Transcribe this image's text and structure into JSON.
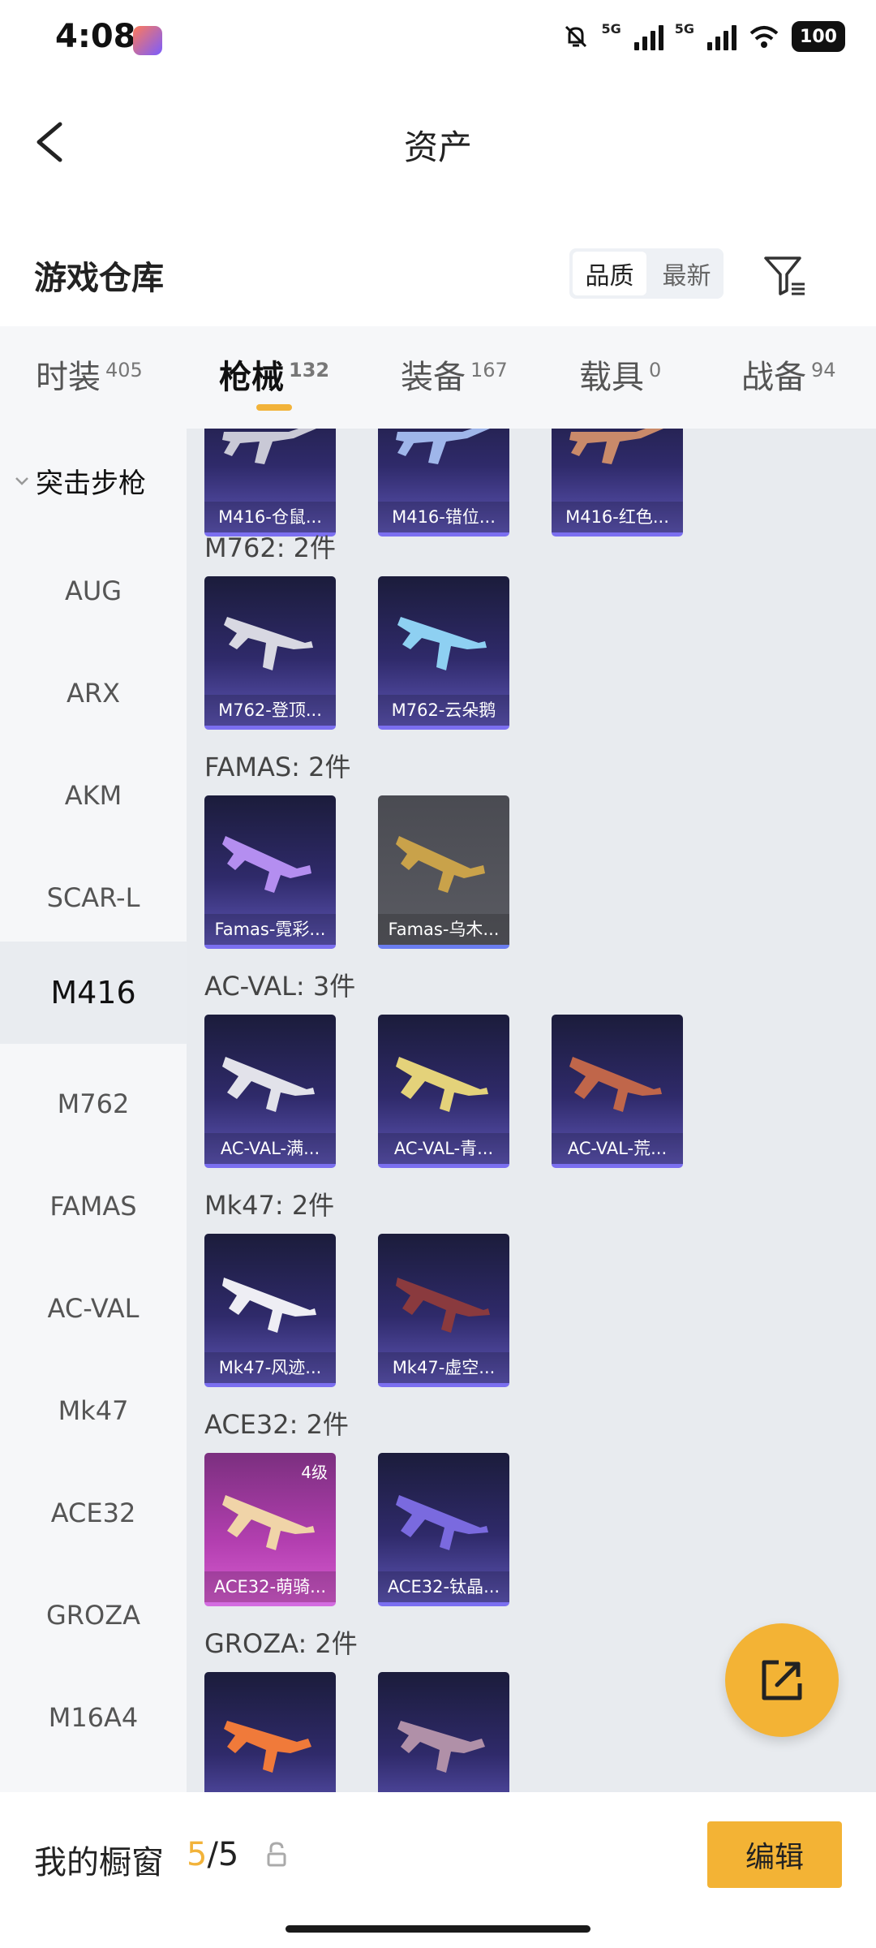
{
  "status": {
    "time": "4:08",
    "battery": "100",
    "net1": "5G",
    "net2": "5G"
  },
  "header": {
    "title": "资产"
  },
  "section": {
    "title": "游戏仓库",
    "sort_options": [
      "品质",
      "最新"
    ],
    "active_sort": "品质"
  },
  "tabs": [
    {
      "label": "时装",
      "count": "405"
    },
    {
      "label": "枪械",
      "count": "132"
    },
    {
      "label": "装备",
      "count": "167"
    },
    {
      "label": "载具",
      "count": "0"
    },
    {
      "label": "战备",
      "count": "94"
    }
  ],
  "active_tab": "枪械",
  "sidebar": {
    "category": "突击步枪",
    "items": [
      "AUG",
      "ARX",
      "AKM",
      "SCAR-L",
      "M416",
      "M762",
      "FAMAS",
      "AC-VAL",
      "Mk47",
      "ACE32",
      "GROZA",
      "M16A4"
    ],
    "active": "M416"
  },
  "groups": [
    {
      "title": "",
      "items": [
        {
          "label": "M416-仓鼠..."
        },
        {
          "label": "M416-错位..."
        },
        {
          "label": "M416-红色..."
        }
      ]
    },
    {
      "title": "M762: 2件",
      "items": [
        {
          "label": "M762-登顶..."
        },
        {
          "label": "M762-云朵鹅"
        }
      ]
    },
    {
      "title": "FAMAS: 2件",
      "items": [
        {
          "label": "Famas-霓彩..."
        },
        {
          "label": "Famas-乌木..."
        }
      ]
    },
    {
      "title": "AC-VAL: 3件",
      "items": [
        {
          "label": "AC-VAL-满..."
        },
        {
          "label": "AC-VAL-青..."
        },
        {
          "label": "AC-VAL-荒..."
        }
      ]
    },
    {
      "title": "Mk47: 2件",
      "items": [
        {
          "label": "Mk47-风迹..."
        },
        {
          "label": "Mk47-虚空..."
        }
      ]
    },
    {
      "title": "ACE32: 2件",
      "items": [
        {
          "label": "ACE32-萌骑...",
          "badge": "4级"
        },
        {
          "label": "ACE32-钛晶..."
        }
      ]
    },
    {
      "title": "GROZA: 2件",
      "items": [
        {
          "label": ""
        },
        {
          "label": ""
        }
      ]
    }
  ],
  "bottom": {
    "showcase_label": "我的橱窗",
    "current": "5",
    "total": "/5",
    "edit_label": "编辑"
  },
  "colors": {
    "accent": "#f3b335",
    "card_purple": "#2f2a6a"
  }
}
